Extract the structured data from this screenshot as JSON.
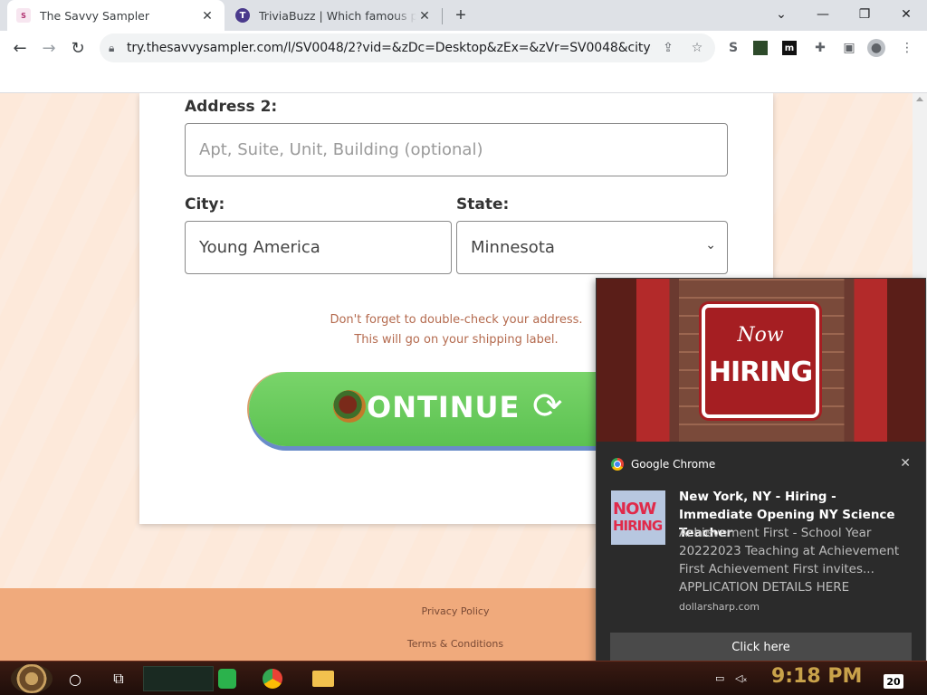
{
  "browser": {
    "tabs": [
      {
        "title": "The Savvy Sampler",
        "active": true,
        "favicon": "savvy-sampler-favicon"
      },
      {
        "title": "TriviaBuzz | Which famous person",
        "active": false,
        "favicon": "triviabuzz-favicon"
      }
    ],
    "url": "try.thesavvysampler.com/l/SV0048/2?vid=&zDc=Desktop&zEx=&zVr=SV0048&city=&c...",
    "window_controls": {
      "minimize": "—",
      "maximize": "❐",
      "close": "✕"
    },
    "toolbar_icons": {
      "back": "←",
      "forward": "→",
      "reload": "↻",
      "share": "⇪",
      "star": "☆",
      "menu": "⋮"
    }
  },
  "form": {
    "address2_label": "Address 2:",
    "address2_placeholder": "Apt, Suite, Unit, Building (optional)",
    "city_label": "City:",
    "city_value": "Young America",
    "state_label": "State:",
    "state_value": "Minnesota",
    "hint_line1": "Don't forget to double-check your address.",
    "hint_line2": "This will go on your shipping label.",
    "continue_label": "CONTINUE",
    "continue_label_visible": "ONTINUE"
  },
  "footer": {
    "privacy": "Privacy Policy",
    "terms": "Terms & Conditions"
  },
  "notification": {
    "app_name": "Google Chrome",
    "hero_now": "Now",
    "hero_hiring": "HIRING",
    "thumb_now": "NOW",
    "thumb_hiring": "HIRING",
    "title": "New York, NY - Hiring - Immediate Opening NY Science Teacher",
    "body": "Achievement First - School Year 20222023 Teaching at Achievement First Achievement First invites... APPLICATION DETAILS HERE",
    "source": "dollarsharp.com",
    "action": "Click here"
  },
  "taskbar": {
    "time": "9:18 PM",
    "notification_count": "20"
  },
  "colors": {
    "button_green": "#5cc251",
    "page_peach": "#fde7d6",
    "footer_orange": "#f0aa7c",
    "hint_text": "#b46a4e",
    "notification_bg": "#2b2b2b"
  }
}
